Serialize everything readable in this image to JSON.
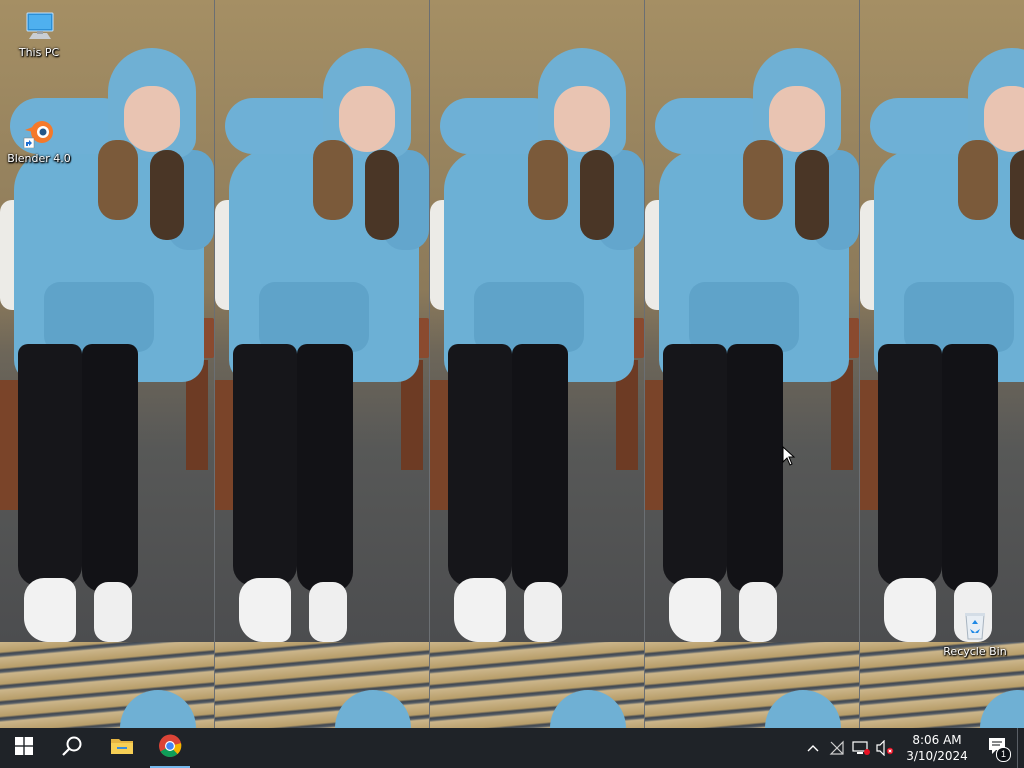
{
  "desktop": {
    "icons": [
      {
        "label": "This PC",
        "icon": "computer-icon"
      },
      {
        "label": "Blender 4.0",
        "icon": "blender-icon"
      },
      {
        "label": "Recycle Bin",
        "icon": "recycle-bin-icon"
      }
    ]
  },
  "taskbar": {
    "start": {
      "icon": "windows-start-icon"
    },
    "search": {
      "icon": "search-icon"
    },
    "pinned": [
      {
        "name": "File Explorer",
        "icon": "folder-icon"
      },
      {
        "name": "Google Chrome",
        "icon": "chrome-icon",
        "active": true
      }
    ],
    "tray": {
      "icons": [
        "chevron-up-icon",
        "network-disconnected-icon",
        "ethernet-icon",
        "volume-muted-icon"
      ],
      "time": "8:06 AM",
      "date": "3/10/2024",
      "notification_count": "1"
    }
  },
  "colors": {
    "taskbar_bg": "#0c1016",
    "accent": "#76b9ed",
    "hoodie": "#6cb0d5"
  }
}
